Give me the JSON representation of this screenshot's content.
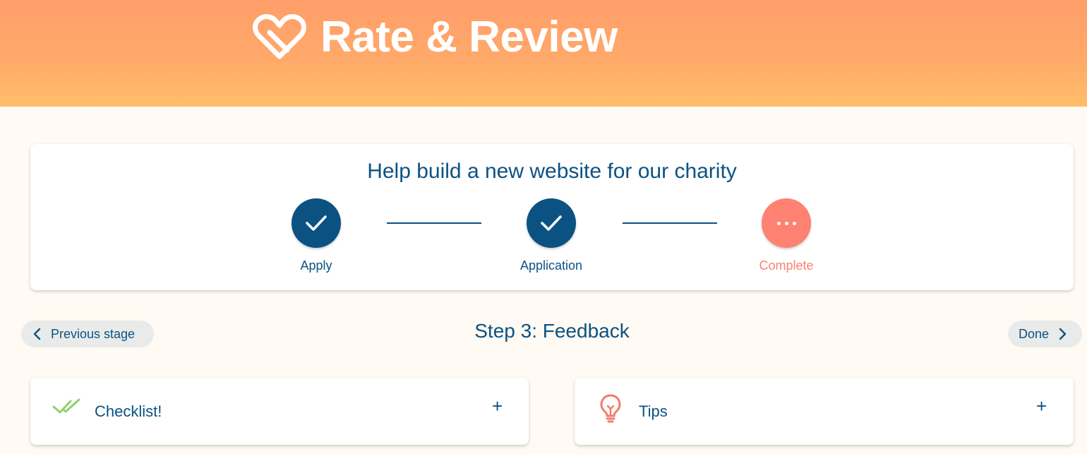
{
  "header": {
    "title": "Rate & Review",
    "logo_icon": "heart-icon",
    "gradient_top": "#ff9e6a",
    "gradient_bottom": "#ffbd6a"
  },
  "progress": {
    "title": "Help build a new website for our charity",
    "steps": [
      {
        "label": "Apply",
        "status": "done",
        "icon": "check-icon"
      },
      {
        "label": "Application",
        "status": "done",
        "icon": "check-icon"
      },
      {
        "label": "Complete",
        "status": "current",
        "icon": "more-dots-icon"
      }
    ],
    "colors": {
      "done": "#0b5283",
      "current": "#fe8171"
    }
  },
  "stage_nav": {
    "previous_label": "Previous stage",
    "heading": "Step 3: Feedback",
    "next_label": "Done"
  },
  "panels": [
    {
      "label": "Checklist!",
      "icon": "double-check-icon",
      "expand_icon": "plus-icon",
      "expand_symbol": "+"
    },
    {
      "label": "Tips",
      "icon": "lightbulb-icon",
      "expand_icon": "plus-icon",
      "expand_symbol": "+"
    }
  ]
}
